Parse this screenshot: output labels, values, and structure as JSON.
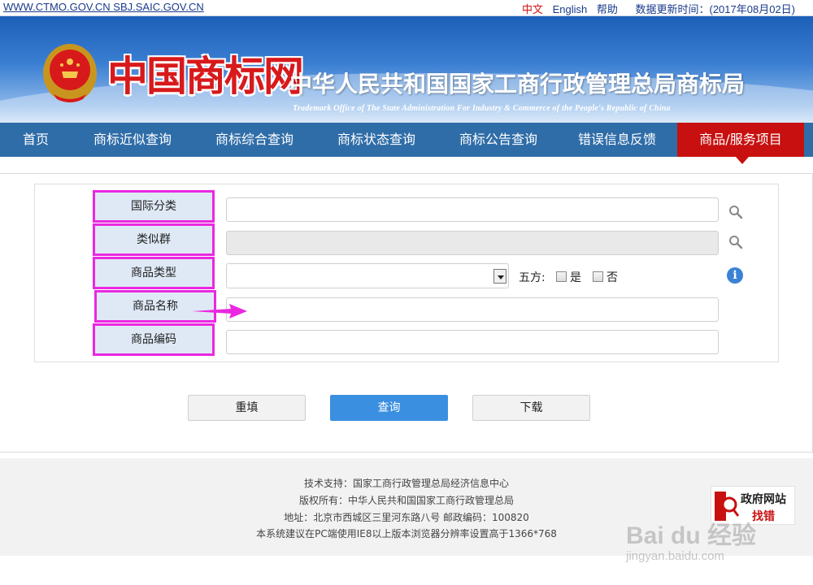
{
  "topbar": {
    "urls": "WWW.CTMO.GOV.CN SBJ.SAIC.GOV.CN",
    "lang_cn": "中文",
    "lang_en": "English",
    "help": "帮助",
    "update_time": "数据更新时间：(2017年08月02日)"
  },
  "banner": {
    "logo_text": "中国商标网",
    "org_cn": "中华人民共和国国家工商行政管理总局商标局",
    "org_en": "Trademark Office of The State Administration For Industry & Commerce of the People's Republic of China"
  },
  "nav": {
    "items": [
      "首页",
      "商标近似查询",
      "商标综合查询",
      "商标状态查询",
      "商标公告查询",
      "错误信息反馈",
      "商品/服务项目"
    ],
    "active_index": 6
  },
  "form": {
    "labels": {
      "intl_class": "国际分类",
      "similar_group": "类似群",
      "goods_type": "商品类型",
      "goods_name": "商品名称",
      "goods_code": "商品编码"
    },
    "wufang_label": "五方:",
    "option_yes": "是",
    "option_no": "否",
    "goods_type_value": "",
    "intl_class_value": "",
    "goods_name_value": "",
    "goods_code_value": ""
  },
  "buttons": {
    "reset": "重填",
    "query": "查询",
    "download": "下载"
  },
  "footer": {
    "support": "技术支持：国家工商行政管理总局经济信息中心",
    "copyright": "版权所有：中华人民共和国国家工商行政管理总局",
    "address": "地址：北京市西城区三里河东路八号  邮政编码：100820",
    "advice": "本系统建议在PC端使用IE8以上版本浏览器分辨率设置高于1366*768",
    "badge_line1": "政府网站",
    "badge_line2": "找错"
  },
  "watermark": {
    "brand": "Bai du 经验",
    "url": "jingyan.baidu.com"
  },
  "colors": {
    "nav_bg": "#2f6da8",
    "nav_active": "#c81010",
    "label_highlight": "#ea28e0",
    "primary_button": "#3b8fe0"
  }
}
